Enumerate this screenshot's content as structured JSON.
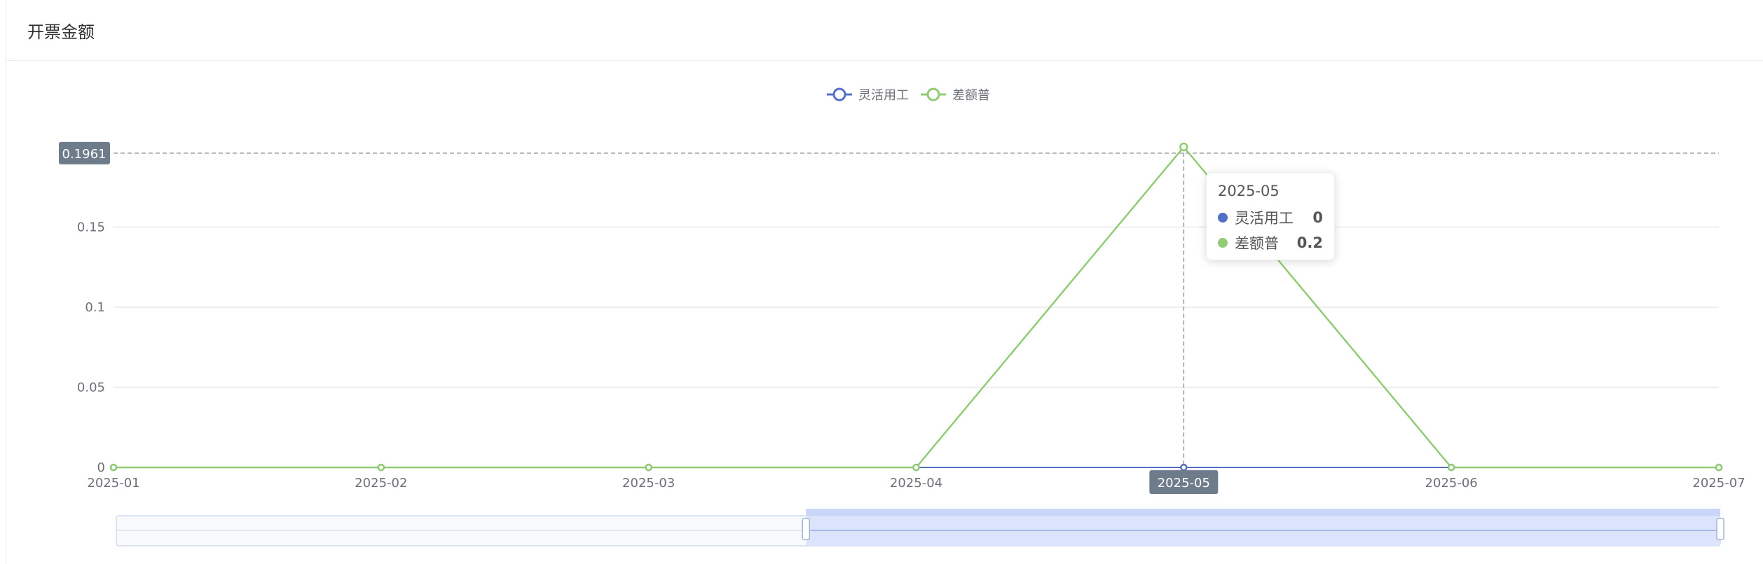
{
  "panel": {
    "title": "开票金额"
  },
  "tooltip": {
    "title": "2025-05",
    "rows": [
      {
        "name": "灵活用工",
        "value": "0",
        "color": "#5470c6"
      },
      {
        "name": "差额普",
        "value": "0.2",
        "color": "#91cc75"
      }
    ]
  },
  "chart_data": {
    "type": "line",
    "categories": [
      "2025-01",
      "2025-02",
      "2025-03",
      "2025-04",
      "2025-05",
      "2025-06",
      "2025-07"
    ],
    "series": [
      {
        "name": "灵活用工",
        "color": "#5470c6",
        "values": [
          0,
          0,
          0,
          0,
          0,
          0,
          0
        ]
      },
      {
        "name": "差额普",
        "color": "#91cc75",
        "values": [
          0,
          0,
          0,
          0,
          0.2,
          0,
          0
        ]
      }
    ],
    "yticks": [
      "0",
      "0.05",
      "0.1",
      "0.15"
    ],
    "ylim": [
      0,
      0.2
    ],
    "grid": true,
    "legend_position": "top-center",
    "axis_pointer": {
      "x_label": "2025-05",
      "y_label": "0.1961",
      "y_value": 0.1961
    },
    "data_zoom": {
      "start_percent": 43,
      "end_percent": 100
    }
  }
}
